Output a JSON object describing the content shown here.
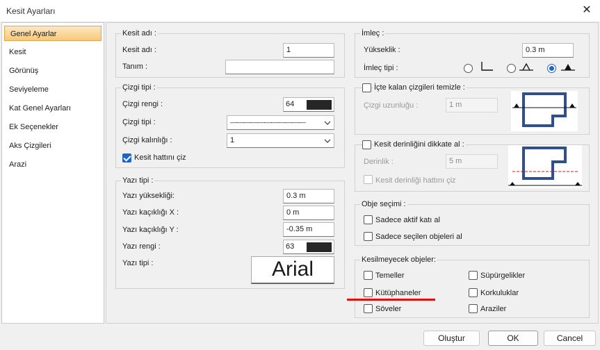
{
  "window": {
    "title": "Kesit Ayarları"
  },
  "sidebar": {
    "items": [
      {
        "label": "Genel Ayarlar"
      },
      {
        "label": "Kesit"
      },
      {
        "label": "Görünüş"
      },
      {
        "label": "Seviyeleme"
      },
      {
        "label": "Kat Genel Ayarları"
      },
      {
        "label": "Ek Seçenekler"
      },
      {
        "label": "Aks Çizgileri"
      },
      {
        "label": "Arazi"
      }
    ]
  },
  "kesit_adi": {
    "legend": "Kesit adı :",
    "name_label": "Kesit adı :",
    "name_value": "1",
    "desc_label": "Tanım :",
    "desc_value": ""
  },
  "cizgi_tipi": {
    "legend": "Çizgi tipi :",
    "color_label": "Çizgi rengi :",
    "color_value": "64",
    "type_label": "Çizgi tipi :",
    "type_value": "—·—·—·—·—·—·—·—·—·—·—",
    "width_label": "Çizgi kalınlığı :",
    "width_value": "1",
    "section_line_label": "Kesit hattını çiz",
    "section_line_checked": true
  },
  "yazi_tipi": {
    "legend": "Yazı tipi :",
    "height_label": "Yazı yüksekliği:",
    "height_value": "0.3 m",
    "offx_label": "Yazı kaçıklığı X :",
    "offx_value": "0 m",
    "offy_label": "Yazı kaçıklığı Y :",
    "offy_value": "-0.35 m",
    "color_label": "Yazı rengi :",
    "color_value": "63",
    "font_label": "Yazı tipi :",
    "font_value": "Arial"
  },
  "imlec": {
    "legend": "İmleç :",
    "height_label": "Yükseklik :",
    "height_value": "0.3 m",
    "type_label": "İmleç tipi :",
    "selected_index": 2
  },
  "icte_kalan": {
    "label": "İçte kalan çizgileri temizle :",
    "checked": false,
    "length_label": "Çizgi uzunluğu :",
    "length_value": "1 m"
  },
  "derinlik": {
    "label": "Kesit derinliğini dikkate al :",
    "checked": false,
    "depth_label": "Derinlik :",
    "depth_value": "5 m",
    "depth_line_label": "Kesit derinliği hattını çiz"
  },
  "obje_secimi": {
    "legend": "Obje seçimi :",
    "opt1_label": "Sadece aktif katı al",
    "opt2_label": "Sadece seçilen objeleri al"
  },
  "kesilmeyecek": {
    "legend": "Kesilmeyecek objeler:",
    "items": [
      {
        "label": "Temeller"
      },
      {
        "label": "Süpürgelikler"
      },
      {
        "label": "Kütüphaneler"
      },
      {
        "label": "Korkuluklar"
      },
      {
        "label": "Söveler"
      },
      {
        "label": "Araziler"
      }
    ]
  },
  "buttons": {
    "create": "Oluştur",
    "ok": "OK",
    "cancel": "Cancel"
  },
  "colors": {
    "accent": "#1d66c6",
    "highlight_line": "#e01010",
    "sidebar_active": "#f8c879"
  }
}
